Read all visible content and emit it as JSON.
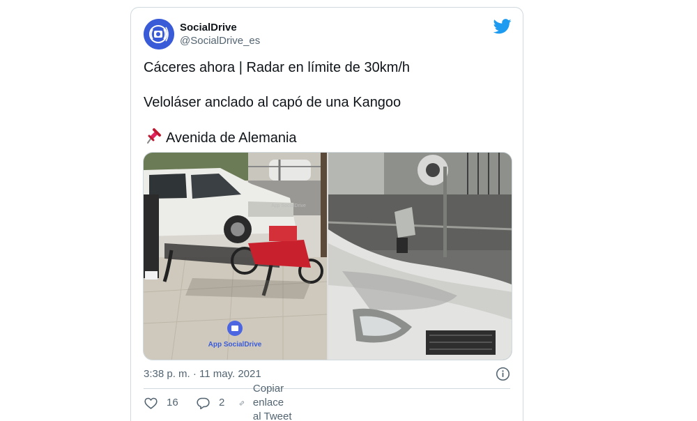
{
  "tweet": {
    "author_name": "SocialDrive",
    "author_handle": "@SocialDrive_es",
    "lines": [
      "Cáceres ahora | Radar en límite de 30km/h",
      "Veloláser anclado al capó de una Kangoo",
      "Avenida de Alemania"
    ],
    "pin_icon": "pushpin-icon",
    "timestamp": "3:38 p. m. · 11 may. 2021",
    "watermark_app": "App SocialDrive",
    "watermark_small": "App SocialDrive"
  },
  "actions": {
    "like_count": "16",
    "reply_count": "2",
    "copy_link_label": "Copiar enlace al Tweet"
  },
  "colors": {
    "twitter_blue": "#1d9bf0",
    "text_secondary": "#536471",
    "avatar_blue": "#3a5bd8"
  }
}
